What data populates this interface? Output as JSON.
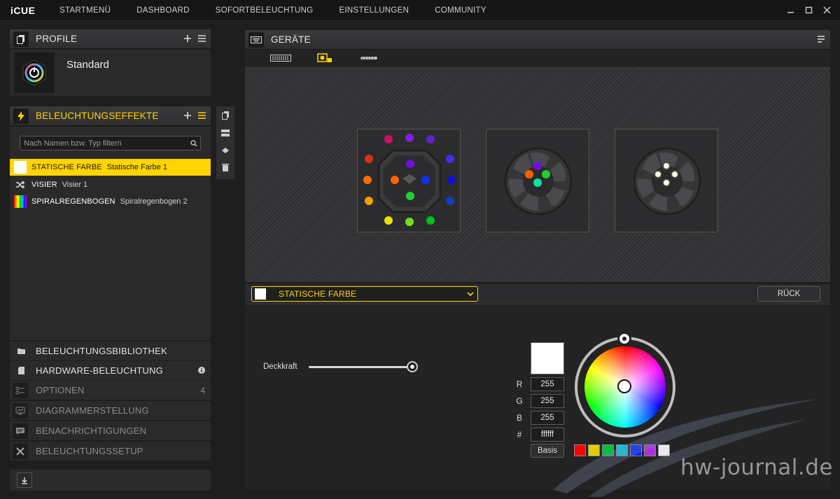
{
  "app": {
    "brand": "iCUE",
    "nav": [
      "STARTMENÜ",
      "DASHBOARD",
      "SOFORTBELEUCHTUNG",
      "EINSTELLUNGEN",
      "COMMUNITY"
    ]
  },
  "profile_panel": {
    "title": "PROFILE",
    "profile_name": "Standard"
  },
  "effects_panel": {
    "title": "BELEUCHTUNGSEFFEKTE",
    "filter_placeholder": "Nach Namen bzw. Typ filtern",
    "items": [
      {
        "type": "STATISCHE FARBE",
        "name": "Statische Farbe 1",
        "active": true
      },
      {
        "type": "VISIER",
        "name": "Visier 1",
        "active": false
      },
      {
        "type": "SPIRALREGENBOGEN",
        "name": "Spiralregenbogen 2",
        "active": false
      }
    ]
  },
  "sections": [
    {
      "label": "BELEUCHTUNGSBIBLIOTHEK",
      "icon": "folder-icon"
    },
    {
      "label": "HARDWARE-BELEUCHTUNG",
      "icon": "device-icon",
      "badge": "info-icon"
    },
    {
      "label": "OPTIONEN",
      "icon": "options-icon",
      "count": "4"
    },
    {
      "label": "DIAGRAMMERSTELLUNG",
      "icon": "graph-icon"
    },
    {
      "label": "BENACHRICHTIGUNGEN",
      "icon": "notification-icon"
    },
    {
      "label": "BELEUCHTUNGSSETUP",
      "icon": "tools-icon"
    }
  ],
  "devices_panel": {
    "title": "GERÄTE"
  },
  "editor": {
    "selected_effect": "STATISCHE FARBE",
    "back_label": "RÜCK",
    "opacity_label": "Deckkraft",
    "opacity_percent": 100,
    "rgb": {
      "r_label": "R",
      "g_label": "G",
      "b_label": "B",
      "hex_label": "#",
      "r": "255",
      "g": "255",
      "b": "255",
      "hex": "ffffff"
    },
    "basis_label": "Basis",
    "current_color": "#ffffff",
    "presets": [
      "#ff0000",
      "#e0d000",
      "#00c040",
      "#00d0e0",
      "#0020ff",
      "#b030e0",
      "#e8e8f0"
    ]
  },
  "colors": {
    "accent": "#ffd400",
    "panel": "#2a2a2b",
    "background": "#1e1e1f"
  },
  "watermark": "hw-journal.de"
}
